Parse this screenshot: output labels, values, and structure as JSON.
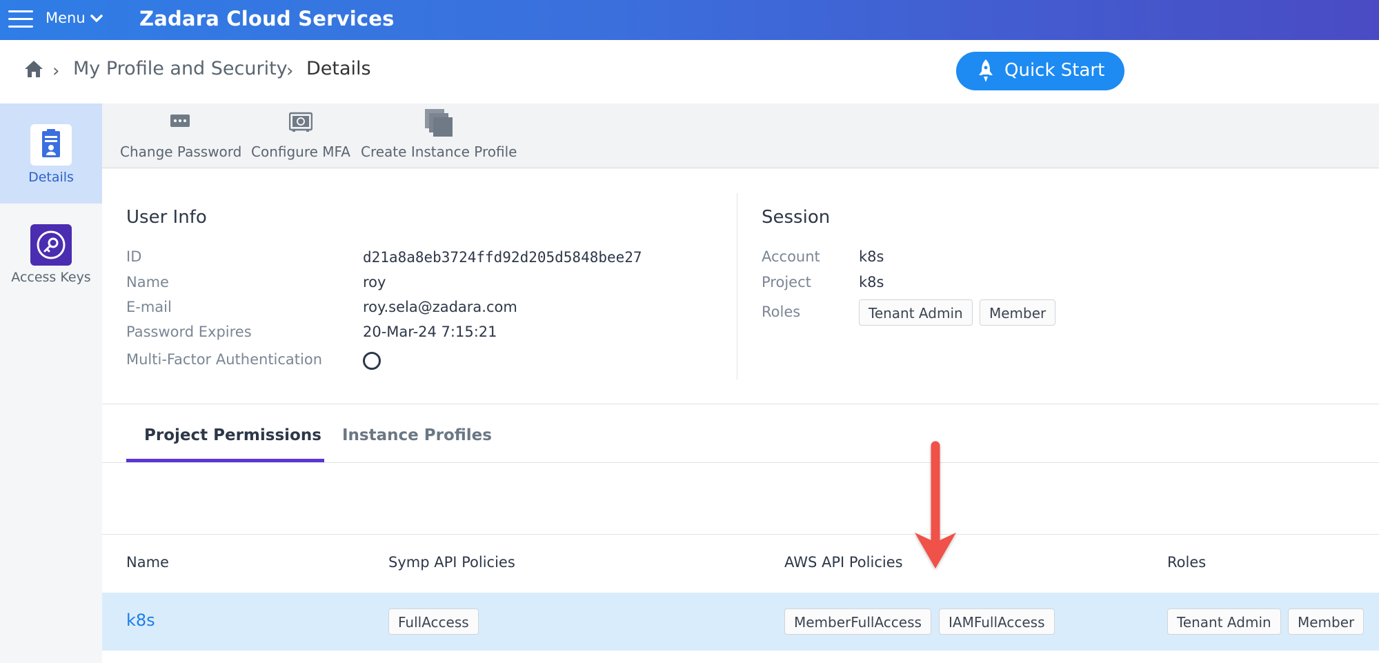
{
  "header": {
    "menu_label": "Menu",
    "app_title": "Zadara Cloud Services"
  },
  "breadcrumb": {
    "items": [
      "My Profile and Security",
      "Details"
    ]
  },
  "quick_start": {
    "label": "Quick Start"
  },
  "sidebar": {
    "items": [
      {
        "label": "Details"
      },
      {
        "label": "Access Keys"
      }
    ]
  },
  "toolbar": {
    "change_password": "Change Password",
    "configure_mfa": "Configure MFA",
    "create_instance_profile": "Create Instance Profile"
  },
  "user_info": {
    "title": "User Info",
    "fields": [
      {
        "label": "ID",
        "value": "d21a8a8eb3724ffd92d205d5848bee27"
      },
      {
        "label": "Name",
        "value": "roy"
      },
      {
        "label": "E-mail",
        "value": "roy.sela@zadara.com"
      },
      {
        "label": "Password Expires",
        "value": "20-Mar-24 7:15:21"
      },
      {
        "label": "Multi-Factor Authentication",
        "value": ""
      }
    ]
  },
  "session": {
    "title": "Session",
    "account_label": "Account",
    "account": "k8s",
    "project_label": "Project",
    "project": "k8s",
    "roles_label": "Roles",
    "roles": [
      "Tenant Admin",
      "Member"
    ]
  },
  "tabs": [
    {
      "label": "Project Permissions",
      "active": true
    },
    {
      "label": "Instance Profiles",
      "active": false
    }
  ],
  "permissions_table": {
    "columns": [
      "Name",
      "Symp API Policies",
      "AWS API Policies",
      "Roles"
    ],
    "rows": [
      {
        "name": "k8s",
        "symp_policies": [
          "FullAccess"
        ],
        "aws_policies": [
          "MemberFullAccess",
          "IAMFullAccess"
        ],
        "roles": [
          "Tenant Admin",
          "Member"
        ]
      }
    ]
  },
  "colors": {
    "topbar_start": "#2f7de6",
    "topbar_end": "#4a4bc4",
    "quick_start": "#1d8bf1",
    "active_tab": "#5b34d4",
    "selected_row": "#d9ecfb",
    "annotation_arrow": "#f0514a"
  }
}
